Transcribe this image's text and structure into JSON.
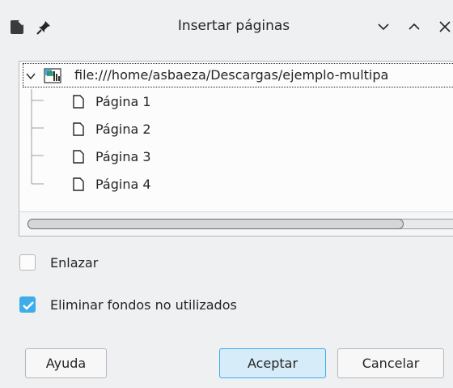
{
  "window": {
    "title": "Insertar páginas",
    "controls": [
      "minimize",
      "maximize",
      "close"
    ]
  },
  "tree": {
    "root_label": "file:///home/asbaeza/Descargas/ejemplo-multipa",
    "pages": [
      "Página 1",
      "Página 2",
      "Página 3",
      "Página 4"
    ]
  },
  "options": {
    "link_label": "Enlazar",
    "link_checked": false,
    "delete_label": "Eliminar fondos no utilizados",
    "delete_checked": true
  },
  "buttons": {
    "help": "Ayuda",
    "ok": "Aceptar",
    "cancel": "Cancelar"
  },
  "colors": {
    "accent": "#3daee9",
    "background": "#eff0f1"
  }
}
